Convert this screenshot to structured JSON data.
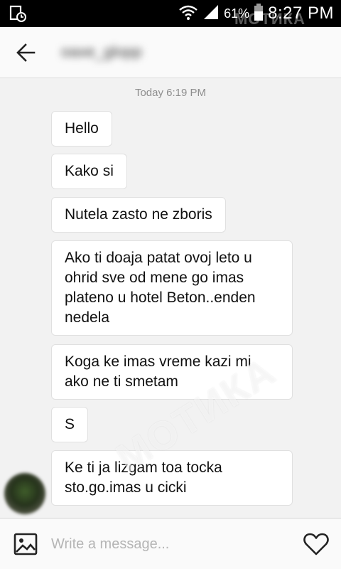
{
  "status_bar": {
    "battery_percent": "61%",
    "time": "8:27 PM",
    "watermark": "МОТИКА",
    "icons": [
      "screenshot-icon",
      "wifi-icon",
      "signal-icon",
      "battery-icon"
    ]
  },
  "header": {
    "contact_name": "oaxe_glopp",
    "back_icon": "back-arrow-icon"
  },
  "chat": {
    "timestamp": "Today 6:19 PM",
    "messages": [
      {
        "text": "Hello"
      },
      {
        "text": "Kako si"
      },
      {
        "text": "Nutela zasto ne zboris"
      },
      {
        "text": "Ako ti doaja patat ovoj leto u ohrid sve od mene go imas plateno u hotel Beton..enden nedela"
      },
      {
        "text": "Koga ke imas vreme kazi mi ako ne ti smetam"
      },
      {
        "text": "S"
      },
      {
        "text": "Ke ti ja lizgam toa tocka sto.go.imas u cicki"
      }
    ],
    "watermark": "МОТИКА"
  },
  "composer": {
    "placeholder": "Write a message...",
    "value": "",
    "gallery_icon": "image-icon",
    "like_icon": "heart-icon"
  },
  "colors": {
    "status_bar": "#000000",
    "background": "#f2f2f2",
    "bubble": "#ffffff",
    "timestamp": "#8e8e8e"
  }
}
